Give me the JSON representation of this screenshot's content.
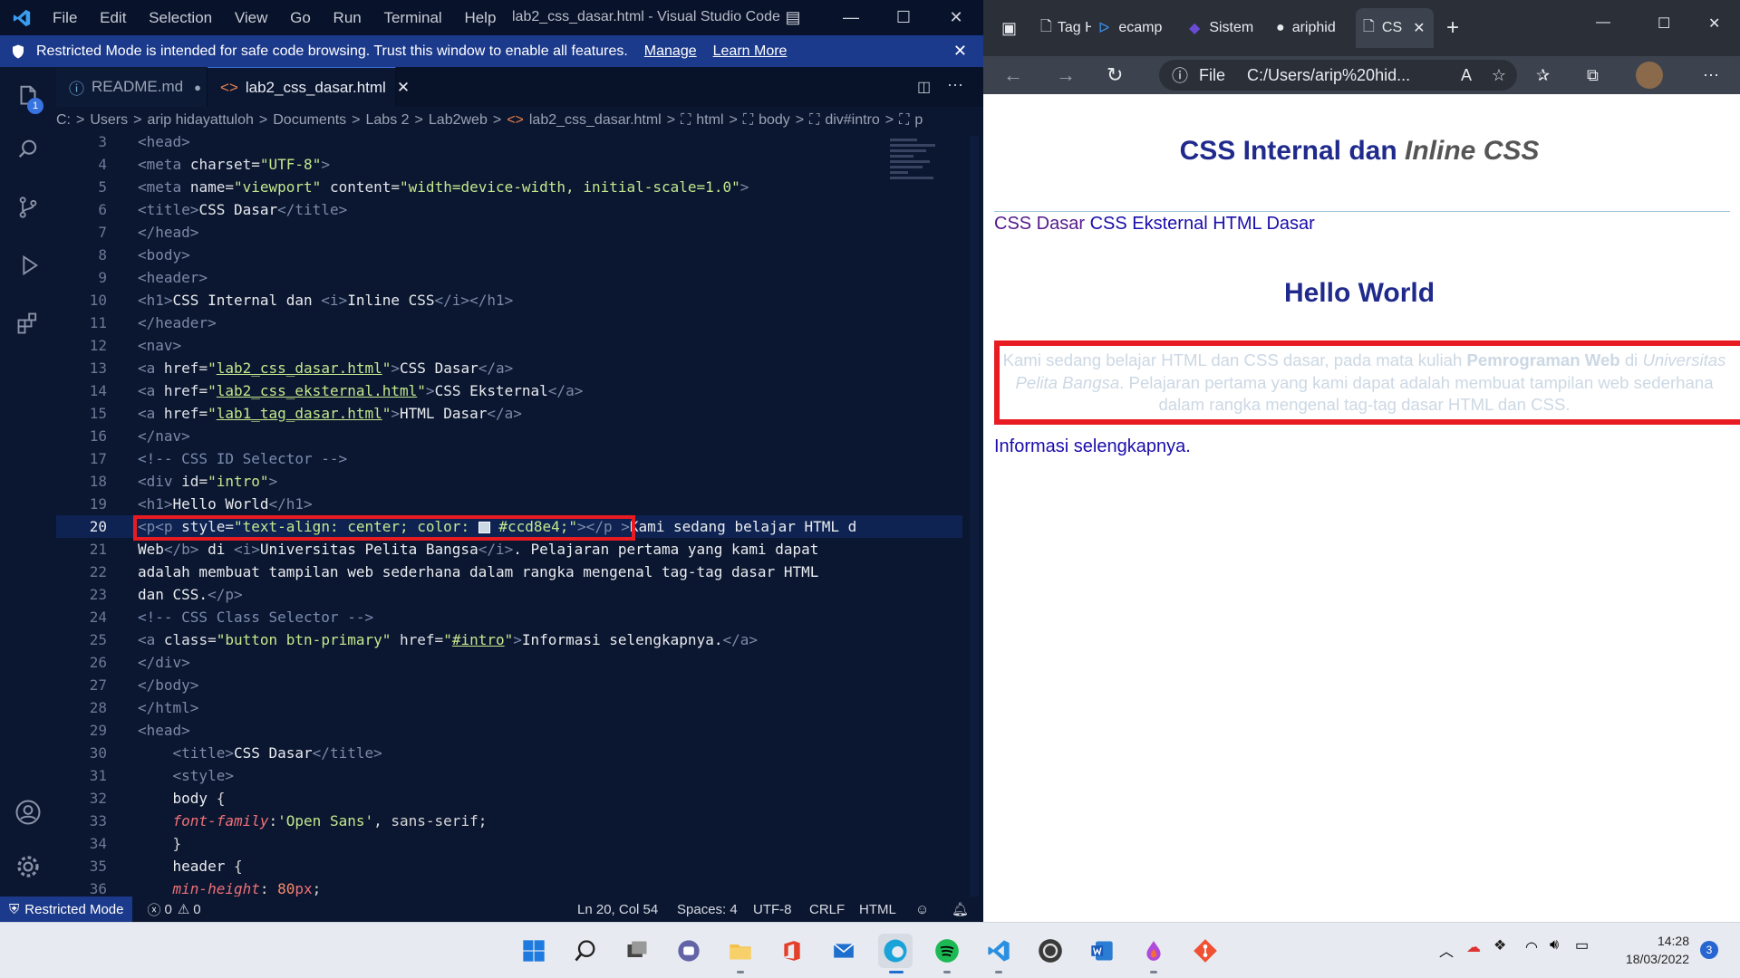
{
  "vscode": {
    "window_title": "lab2_css_dasar.html - Visual Studio Code",
    "menu": [
      "File",
      "Edit",
      "Selection",
      "View",
      "Go",
      "Run",
      "Terminal",
      "Help"
    ],
    "banner": {
      "text": "Restricted Mode is intended for safe code browsing. Trust this window to enable all features.",
      "manage": "Manage",
      "learn_more": "Learn More"
    },
    "activity_badge": "1",
    "tabs": [
      {
        "label": "README.md",
        "modified": true
      },
      {
        "label": "lab2_css_dasar.html",
        "active": true
      }
    ],
    "breadcrumbs": [
      "C:",
      "Users",
      "arip hidayattuloh",
      "Documents",
      "Labs 2",
      "Lab2web",
      "lab2_css_dasar.html",
      "html",
      "body",
      "div#intro",
      "p"
    ],
    "editor": {
      "line_numbers": [
        "3",
        "4",
        "5",
        "6",
        "7",
        "8",
        "9",
        "10",
        "11",
        "12",
        "13",
        "14",
        "15",
        "16",
        "17",
        "18",
        "19",
        "20",
        "21",
        "22",
        "23",
        "24",
        "25",
        "26",
        "27",
        "28",
        "29",
        "30",
        "31",
        "32",
        "33",
        "34",
        "35",
        "36"
      ],
      "color_value": "#ccd8e4"
    },
    "status": {
      "restricted": "Restricted Mode",
      "errors": "0",
      "warnings": "0",
      "position": "Ln 20, Col 54",
      "spaces": "Spaces: 4",
      "encoding": "UTF-8",
      "eol": "CRLF",
      "language": "HTML"
    }
  },
  "browser": {
    "tabs": [
      "Tag HTI",
      "ecamp",
      "Sistem",
      "ariphid",
      "CS"
    ],
    "address": {
      "scheme": "File",
      "url": "C:/Users/arip%20hid..."
    },
    "page": {
      "h1_main": "CSS Internal dan ",
      "h1_italic": "Inline CSS",
      "nav": [
        "CSS Dasar",
        "CSS Eksternal",
        "HTML Dasar"
      ],
      "h1_hello": "Hello World",
      "intro_parts": [
        "Kami sedang belajar HTML dan CSS dasar, pada mata kuliah ",
        "Pemrograman Web",
        " di ",
        "Universitas Pelita Bangsa",
        ". Pelajaran pertama yang kami dapat adalah membuat tampilan web sederhana dalam rangka mengenal tag-tag dasar HTML dan CSS."
      ],
      "more_link": "Informasi selengkapnya.",
      "intro_color": "#ccd8e4"
    }
  },
  "taskbar": {
    "icons": [
      "windows-start-icon",
      "search-icon",
      "task-view-icon",
      "teams-chat-icon",
      "file-explorer-icon",
      "office-icon",
      "mail-icon",
      "edge-icon",
      "spotify-icon",
      "vscode-icon",
      "obs-icon",
      "word-icon",
      "app-icon",
      "git-icon"
    ],
    "time": "14:28",
    "date": "18/03/2022",
    "notification_count": "3"
  }
}
